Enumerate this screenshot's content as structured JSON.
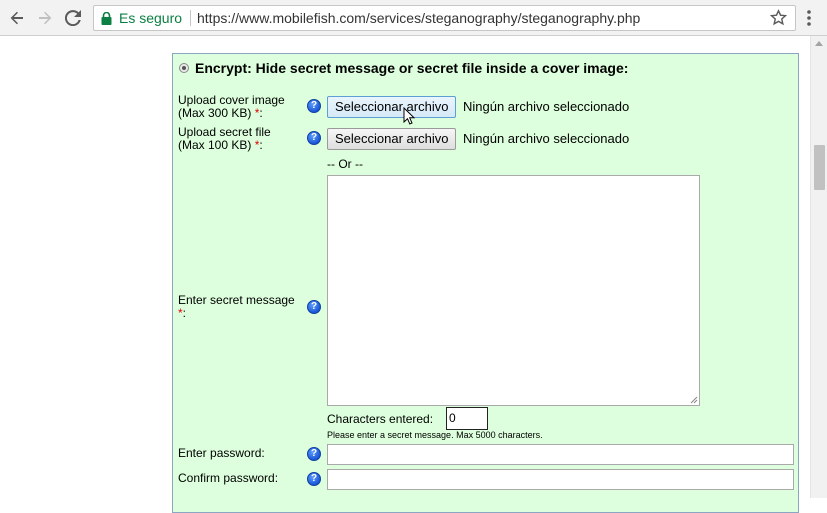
{
  "browser": {
    "secure_label": "Es seguro",
    "url": "https://www.mobilefish.com/services/steganography/steganography.php",
    "icons": [
      "back-arrow-icon",
      "forward-arrow-icon",
      "reload-icon",
      "lock-icon",
      "star-icon",
      "menu-dots-icon"
    ],
    "secure_color": "#0b8043"
  },
  "form": {
    "title": "Encrypt: Hide secret message or secret file inside a cover image:",
    "panel_color": "#ddffdd",
    "cover": {
      "label_line1": "Upload cover image",
      "label_line2": "(Max 300 KB) ",
      "required": "*",
      "suffix": ":",
      "button": "Seleccionar archivo",
      "status": "Ningún archivo seleccionado"
    },
    "secret_file": {
      "label_line1": "Upload secret file",
      "label_line2": "(Max 100 KB) ",
      "required": "*",
      "suffix": ":",
      "button": "Seleccionar archivo",
      "status": "Ningún archivo seleccionado"
    },
    "or_text": "-- Or --",
    "message": {
      "label_line1": "Enter secret message",
      "required": "*",
      "suffix": ":",
      "value": ""
    },
    "characters": {
      "label": "Characters entered:",
      "value": "0",
      "hint": "Please enter a secret message. Max 5000 characters."
    },
    "password": {
      "label": "Enter password:",
      "value": ""
    },
    "confirm_password": {
      "label": "Confirm password:",
      "value": ""
    },
    "help_glyph": "?"
  }
}
